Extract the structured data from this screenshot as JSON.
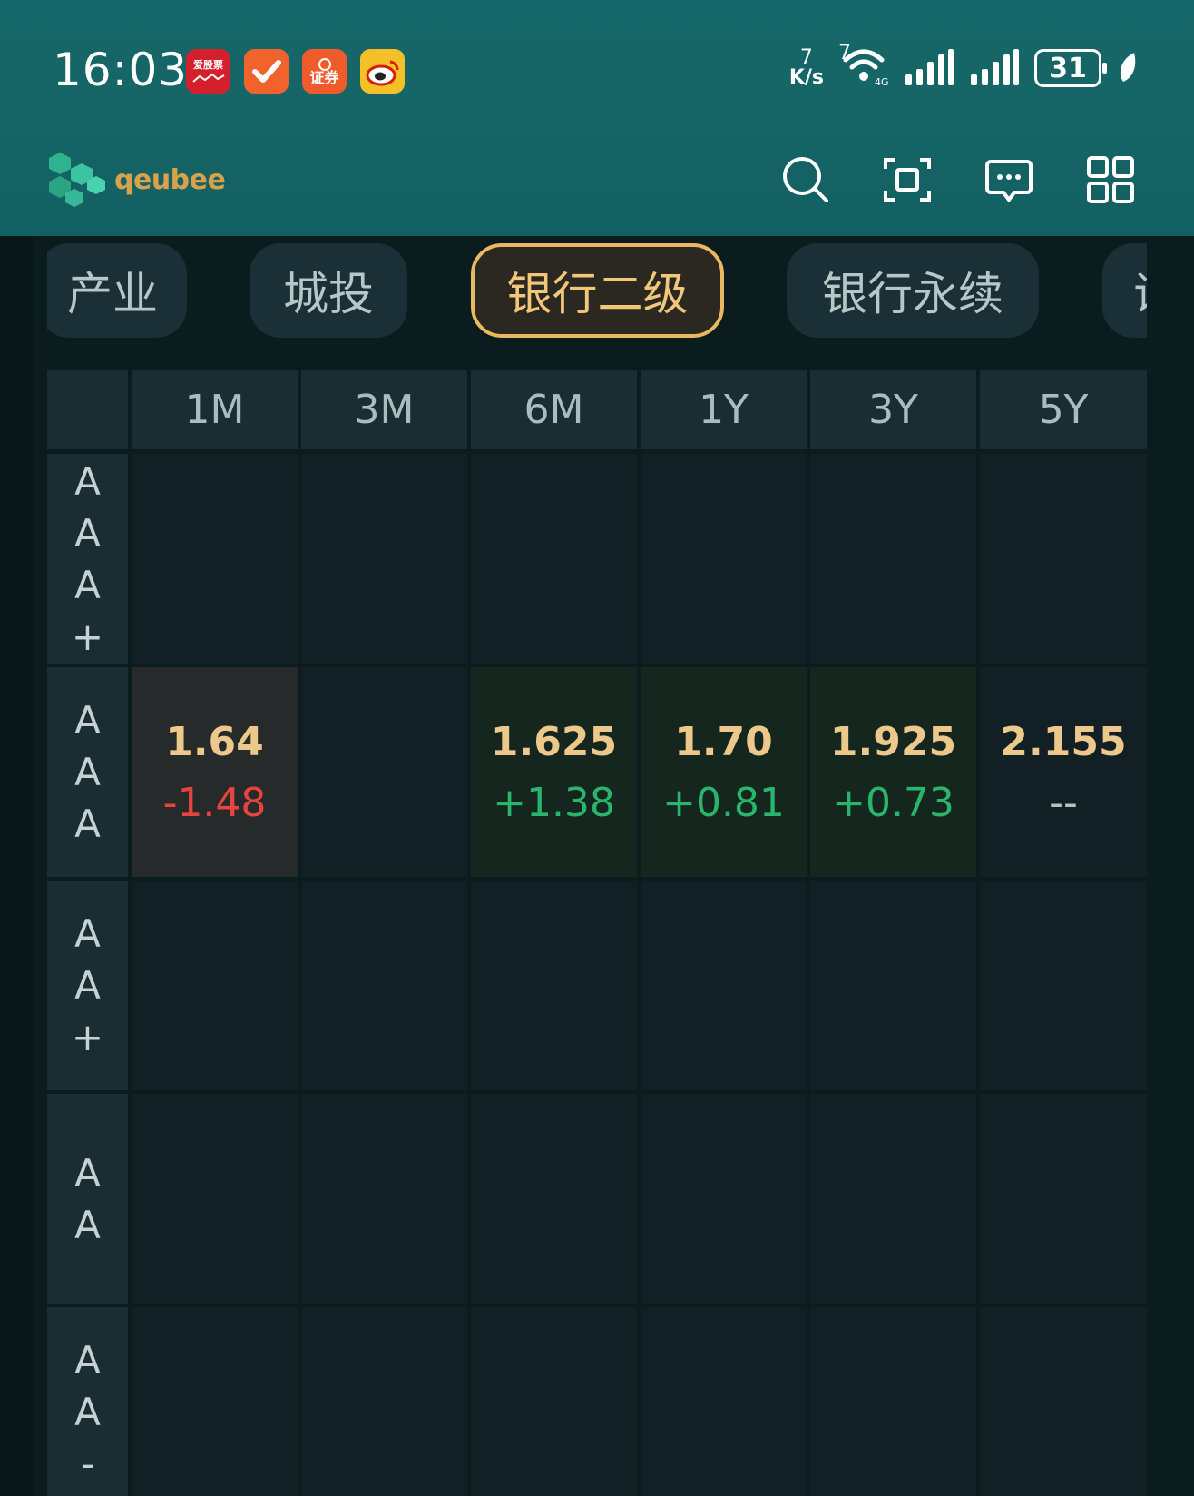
{
  "status_bar": {
    "time": "16:03",
    "net_speed_value": "7",
    "net_speed_unit": "K/s",
    "wifi_badge": "7",
    "battery": "31",
    "app_icons": [
      "aigupiao-icon",
      "checkmark-app-icon",
      "securities-app-icon",
      "weibo-icon"
    ]
  },
  "header": {
    "logo_text": "qeubee",
    "icons": [
      "search-icon",
      "scan-icon",
      "message-icon",
      "apps-grid-icon"
    ]
  },
  "tabs": [
    {
      "label": "产业",
      "active": false
    },
    {
      "label": "城投",
      "active": false
    },
    {
      "label": "银行二级",
      "active": true
    },
    {
      "label": "银行永续",
      "active": false
    },
    {
      "label": "证",
      "active": false
    }
  ],
  "table": {
    "columns": [
      "1M",
      "3M",
      "6M",
      "1Y",
      "3Y",
      "5Y"
    ],
    "rows": [
      {
        "rating": [
          "A",
          "A",
          "A",
          "+"
        ],
        "cells": [
          null,
          null,
          null,
          null,
          null,
          null
        ]
      },
      {
        "rating": [
          "A",
          "A",
          "A"
        ],
        "cells": [
          {
            "value": "1.64",
            "change": "-1.48",
            "dir": "down"
          },
          null,
          {
            "value": "1.625",
            "change": "+1.38",
            "dir": "up"
          },
          {
            "value": "1.70",
            "change": "+0.81",
            "dir": "up"
          },
          {
            "value": "1.925",
            "change": "+0.73",
            "dir": "up"
          },
          {
            "value": "2.155",
            "change": "--",
            "dir": "flat"
          }
        ]
      },
      {
        "rating": [
          "A",
          "A",
          "+"
        ],
        "cells": [
          null,
          null,
          null,
          null,
          null,
          null
        ]
      },
      {
        "rating": [
          "A",
          "A"
        ],
        "cells": [
          null,
          null,
          null,
          null,
          null,
          null
        ]
      },
      {
        "rating": [
          "A",
          "A",
          "-"
        ],
        "cells": [
          null,
          null,
          null,
          null,
          null,
          null
        ]
      }
    ]
  },
  "colors": {
    "topbar": "#136062",
    "accent_gold": "#eab95f",
    "up": "#29b56b",
    "down": "#e8443d"
  }
}
